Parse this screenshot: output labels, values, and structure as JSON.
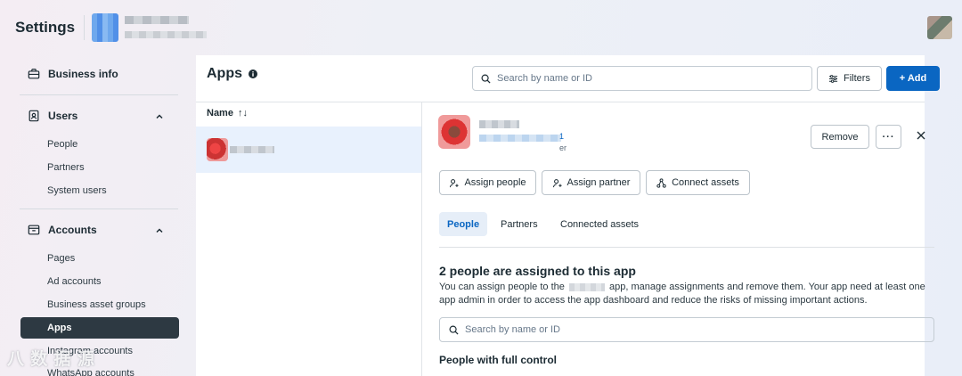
{
  "topbar": {
    "title": "Settings"
  },
  "sidebar": {
    "sections": [
      {
        "label": "Business info",
        "icon": "briefcase-icon"
      },
      {
        "label": "Users",
        "icon": "id-badge-icon",
        "items": [
          "People",
          "Partners",
          "System users"
        ]
      },
      {
        "label": "Accounts",
        "icon": "folder-icon",
        "items": [
          "Pages",
          "Ad accounts",
          "Business asset groups",
          "Apps",
          "Instagram accounts",
          "WhatsApp accounts"
        ]
      }
    ],
    "active_item": "Apps"
  },
  "main": {
    "title": "Apps",
    "search_placeholder": "Search by name or ID",
    "filters_label": "Filters",
    "add_label": "+ Add",
    "list": {
      "column_header": "Name",
      "sort_glyph": "↑↓"
    }
  },
  "detail": {
    "id_fragment": "1",
    "role_fragment": "er",
    "remove_label": "Remove",
    "more_label": "···",
    "actions": [
      "Assign people",
      "Assign partner",
      "Connect assets"
    ],
    "tabs": [
      "People",
      "Partners",
      "Connected assets"
    ],
    "active_tab": "People",
    "assigned_title": "2 people are assigned to this app",
    "assigned_desc_pre": "You can assign people to the",
    "assigned_desc_post": "app, manage assignments and remove them. Your app need at least one app admin in order to access the app dashboard and reduce the risks of missing important actions.",
    "search_placeholder": "Search by name or ID",
    "full_control_heading": "People with full control"
  },
  "watermark": "八 数 据 源",
  "colors": {
    "primary": "#0a66c2",
    "active_nav_bg": "#2d3942",
    "selected_row_bg": "#e8f1fd"
  }
}
